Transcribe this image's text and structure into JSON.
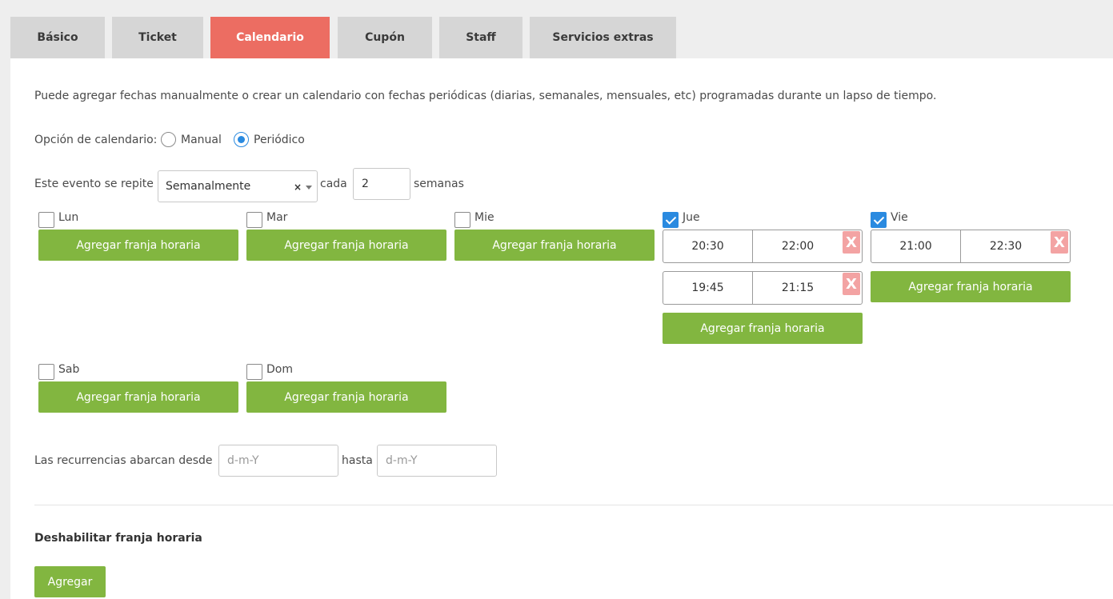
{
  "tabs": [
    {
      "label": "Básico"
    },
    {
      "label": "Ticket"
    },
    {
      "label": "Calendario"
    },
    {
      "label": "Cupón"
    },
    {
      "label": "Staff"
    },
    {
      "label": "Servicios extras"
    }
  ],
  "active_tab": "Calendario",
  "intro_text": "Puede agregar fechas manualmente o crear un calendario con fechas periódicas (diarias, semanales, mensuales, etc) programadas durante un lapso de tiempo.",
  "calendar_option": {
    "label": "Opción de calendario:",
    "options": [
      "Manual",
      "Periódico"
    ],
    "selected": "Periódico"
  },
  "repeat": {
    "label": "Este evento se repite",
    "frequency": "Semanalmente",
    "clear_symbol": "×",
    "every_label": "cada",
    "interval": "2",
    "unit": "semanas"
  },
  "days": [
    {
      "label": "Lun",
      "checked": false,
      "slots": []
    },
    {
      "label": "Mar",
      "checked": false,
      "slots": []
    },
    {
      "label": "Mie",
      "checked": false,
      "slots": []
    },
    {
      "label": "Jue",
      "checked": true,
      "slots": [
        {
          "start": "20:30",
          "end": "22:00"
        },
        {
          "start": "19:45",
          "end": "21:15"
        }
      ]
    },
    {
      "label": "Vie",
      "checked": true,
      "slots": [
        {
          "start": "21:00",
          "end": "22:30"
        }
      ]
    },
    {
      "label": "Sab",
      "checked": false,
      "slots": []
    },
    {
      "label": "Dom",
      "checked": false,
      "slots": []
    }
  ],
  "add_slot_label": "Agregar franja horaria",
  "delete_symbol": "X",
  "recurrence": {
    "label": "Las recurrencias abarcan desde",
    "from_placeholder": "d-m-Y",
    "to_label": "hasta",
    "to_placeholder": "d-m-Y"
  },
  "disable_section": {
    "title": "Deshabilitar franja horaria",
    "button_label": "Agregar"
  },
  "colors": {
    "active_tab": "#ec6d62",
    "button_green": "#82b640",
    "checkbox_blue": "#2a8ae0",
    "delete_pink": "#f3a3a3"
  }
}
